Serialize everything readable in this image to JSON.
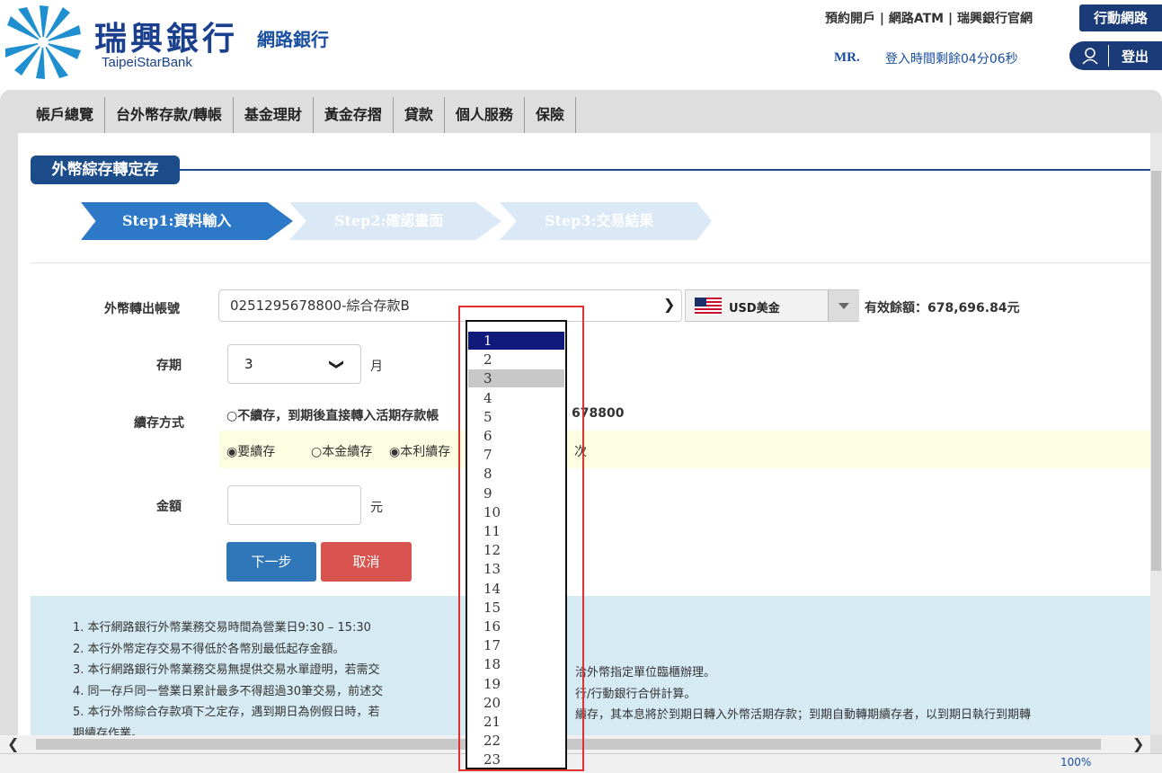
{
  "header": {
    "bank_name": "瑞興銀行",
    "bank_name_en": "TaipeiStarBank",
    "bank_subtitle": "網路銀行",
    "top_links": "預約開戶 | 網路ATM | 瑞興銀行官網",
    "mobile_button": "行動網路",
    "user": "MR.",
    "login_time": "登入時間剩餘04分06秒",
    "logout": "登出",
    "brand_color": "#1b3b78"
  },
  "nav": {
    "items": [
      "帳戶總覽",
      "台外幣存款/轉帳",
      "基金理財",
      "黃金存摺",
      "貸款",
      "個人服務",
      "保險"
    ]
  },
  "page": {
    "title": "外幣綜存轉定存",
    "steps": [
      "Step1:資料輸入",
      "Step2:確認畫面",
      "Step3:交易結果"
    ]
  },
  "form": {
    "account_label": "外幣轉出帳號",
    "account_value": "0251295678800-綜合存款B",
    "currency": "USD美金",
    "balance": "有效餘額：678,696.84元",
    "term_label": "存期",
    "term_value": "3",
    "term_unit": "月",
    "renew_label": "續存方式",
    "renew_no": "○不續存，到期後直接轉入活期存款帳",
    "renew_no_acct": "678800",
    "renew_yes": "◉要續存",
    "renew_principal": "○本金續存",
    "renew_interest": "◉本利續存",
    "renew_times_suffix": "次",
    "amount_label": "金額",
    "amount_unit": "元",
    "next_button": "下一步",
    "cancel_button": "取消"
  },
  "notes": [
    "1.  本行網路銀行外幣業務交易時間為營業日9:30 – 15:30",
    "2.  本行外幣定存交易不得低於各幣別最低起存金額。",
    "3.  本行網路銀行外幣業務交易無提供交易水單證明，若需交",
    "4.  同一存戶同一營業日累計最多不得超過30筆交易，前述交",
    "5.  本行外幣綜合存款項下之定存，遇到期日為例假日時，若",
    "    期續存作業。"
  ],
  "notes_right": [
    "",
    "",
    "洽外幣指定單位臨櫃辦理。",
    "行/行動銀行合併計算。",
    "續存，其本息將於到期日轉入外幣活期存款；到期自動轉期續存者，以到期日執行到期轉",
    ""
  ],
  "dropdown": {
    "options": [
      "1",
      "2",
      "3",
      "4",
      "5",
      "6",
      "7",
      "8",
      "9",
      "10",
      "11",
      "12",
      "13",
      "14",
      "15",
      "16",
      "17",
      "18",
      "19",
      "20",
      "21",
      "22",
      "23"
    ],
    "highlighted": "1",
    "current": "3"
  },
  "status": {
    "zoom": "100%"
  }
}
